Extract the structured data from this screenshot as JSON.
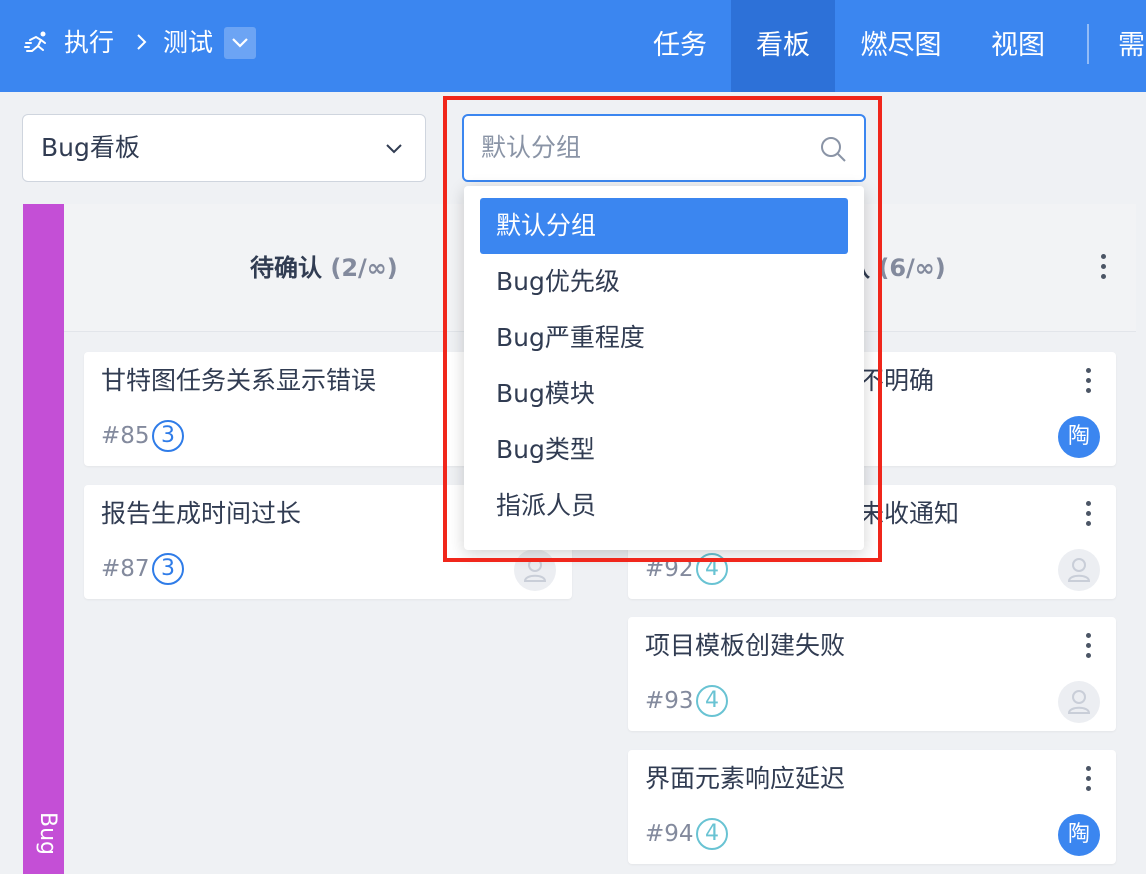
{
  "header": {
    "breadcrumb_root": "执行",
    "breadcrumb_current": "测试",
    "tabs": [
      {
        "label": "任务"
      },
      {
        "label": "看板"
      },
      {
        "label": "燃尽图"
      },
      {
        "label": "视图"
      },
      {
        "label": "需"
      }
    ],
    "active_tab": "看板"
  },
  "board_select": {
    "value": "Bug看板"
  },
  "group_select": {
    "placeholder": "默认分组"
  },
  "group_menu": {
    "items": [
      {
        "label": "默认分组"
      },
      {
        "label": "Bug优先级"
      },
      {
        "label": "Bug严重程度"
      },
      {
        "label": "Bug模块"
      },
      {
        "label": "Bug类型"
      },
      {
        "label": "指派人员"
      }
    ],
    "selected": "默认分组"
  },
  "lane": {
    "label": "Bug",
    "color": "#c44fd6"
  },
  "columns": [
    {
      "title": "待确认",
      "count": "(2/∞)",
      "cards": [
        {
          "title": "甘特图任务关系显示错误",
          "id": "#85",
          "badge": "3"
        },
        {
          "title": "报告生成时间过长",
          "id": "#87",
          "badge": "3"
        }
      ]
    },
    {
      "title": "认",
      "count": "(6/∞)",
      "cards": [
        {
          "title": "不明确",
          "id": "",
          "badge": "",
          "assignee": "陶"
        },
        {
          "title": "未收通知",
          "id": "#92",
          "badge": "4",
          "assignee": ""
        },
        {
          "title": "项目模板创建失败",
          "id": "#93",
          "badge": "4",
          "assignee": ""
        },
        {
          "title": "界面元素响应延迟",
          "id": "#94",
          "badge": "4",
          "assignee": "陶"
        }
      ]
    }
  ],
  "colors": {
    "accent": "#3b86f0",
    "highlight": "#f0261b"
  }
}
